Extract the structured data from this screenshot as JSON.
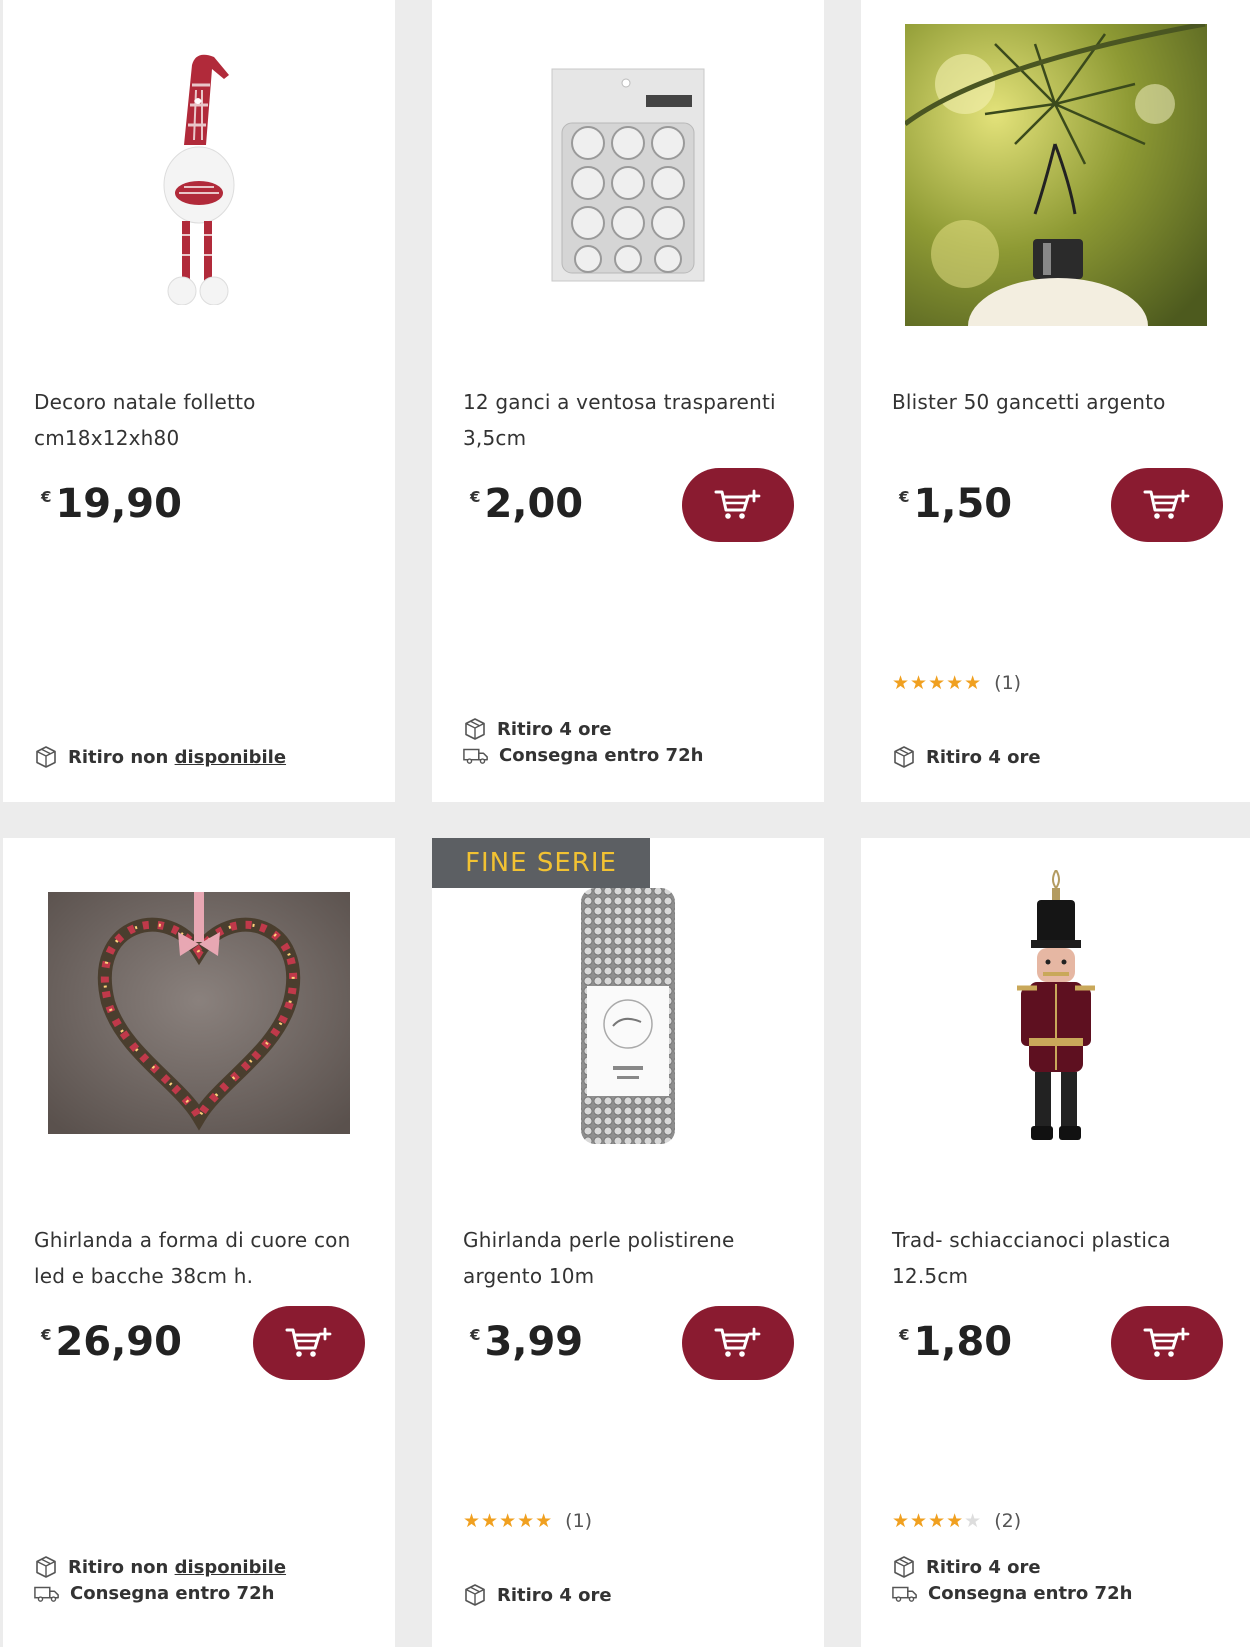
{
  "colors": {
    "accent": "#8a1b30",
    "badge_bg": "#5c5f63",
    "badge_text": "#f2c232",
    "star": "#f0a020"
  },
  "products": [
    {
      "name_line1": "Decoro natale folletto",
      "name_line2": "cm18x12xh80",
      "currency": "€",
      "price": "19,90",
      "image": "gnome-doll",
      "has_cart": false,
      "availability": {
        "pickup_prefix": "Ritiro non",
        "pickup_link": "disponibile"
      }
    },
    {
      "name_line1": "12 ganci a ventosa trasparenti",
      "name_line2": "3,5cm",
      "currency": "€",
      "price": "2,00",
      "image": "suction-hooks-blister",
      "has_cart": true,
      "availability": {
        "pickup": "Ritiro 4 ore",
        "delivery": "Consegna entro 72h"
      }
    },
    {
      "name_line1": "Blister 50 gancetti argento",
      "name_line2": "",
      "currency": "€",
      "price": "1,50",
      "image": "ornament-hook-photo",
      "has_cart": true,
      "rating": {
        "stars": 5,
        "count": "(1)"
      },
      "availability": {
        "pickup": "Ritiro 4 ore"
      }
    },
    {
      "name_line1": "Ghirlanda a forma di cuore con",
      "name_line2": "led e bacche 38cm h.",
      "currency": "€",
      "price": "26,90",
      "image": "heart-garland",
      "has_cart": true,
      "availability": {
        "pickup_prefix": "Ritiro non",
        "pickup_link": "disponibile",
        "delivery": "Consegna entro 72h"
      }
    },
    {
      "badge": "FINE SERIE",
      "name_line1": "Ghirlanda perle polistirene",
      "name_line2": "argento 10m",
      "currency": "€",
      "price": "3,99",
      "image": "silver-bead-garland",
      "has_cart": true,
      "rating": {
        "stars": 5,
        "count": "(1)"
      },
      "availability": {
        "pickup": "Ritiro 4 ore"
      }
    },
    {
      "name_line1": "Trad- schiaccianoci plastica",
      "name_line2": "12.5cm",
      "currency": "€",
      "price": "1,80",
      "image": "nutcracker-ornament",
      "has_cart": true,
      "rating": {
        "stars": 4,
        "count": "(2)"
      },
      "availability": {
        "pickup": "Ritiro 4 ore",
        "delivery": "Consegna entro 72h"
      }
    }
  ]
}
